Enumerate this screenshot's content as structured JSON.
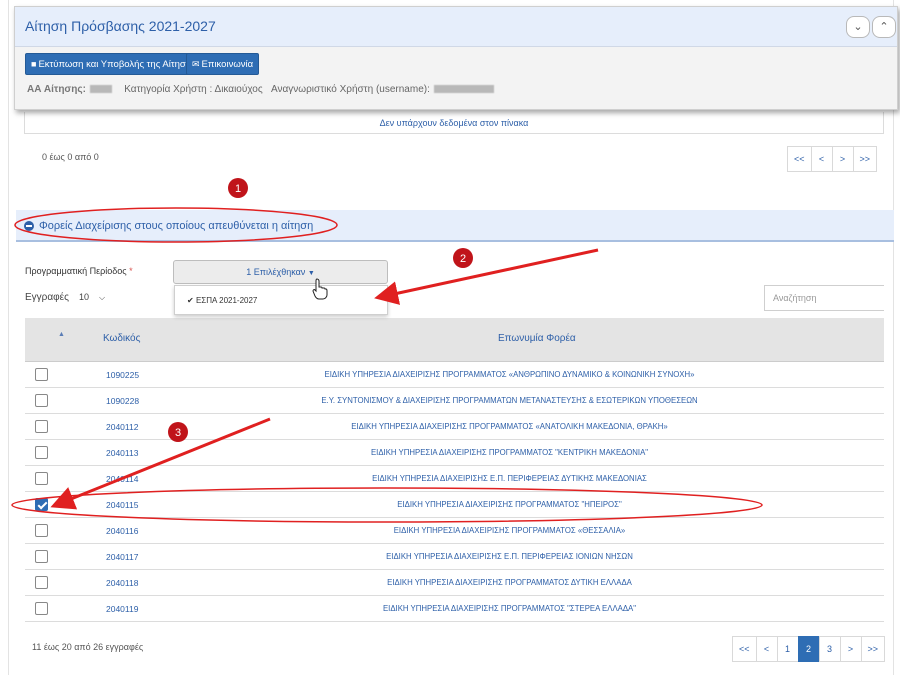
{
  "header": {
    "title": "Αίτηση Πρόσβασης 2021-2027",
    "print_button": "Εκτύπωση και Υποβολής της Αίτησης",
    "contact_button": "Επικοινωνία",
    "application_label": "ΑΑ Αίτησης:",
    "user_category": "Κατηγορία Χρήστη : Δικαιούχος",
    "username_label": "Αναγνωριστικό Χρήστη (username):",
    "collapse_icon": "chevron-down-icon",
    "expand_icon": "chevron-up-icon"
  },
  "top_table": {
    "empty_message": "Δεν υπάρχουν δεδομένα στον πίνακα",
    "summary": "0 έως 0 από 0",
    "pager": [
      "<<",
      "<",
      ">",
      ">>"
    ]
  },
  "section": {
    "title": "Φορείς Διαχείρισης στους οποίους απευθύνεται η αίτηση",
    "period_label": "Προγραμματική Περίοδος",
    "required_mark": "*",
    "period_value": "1 Επιλέχθηκαν",
    "dropdown_option": "ΕΣΠΑ 2021-2027",
    "length_label": "Εγγραφές",
    "length_value": "10",
    "search_placeholder": "Αναζήτηση"
  },
  "table": {
    "columns": [
      "Κωδικός",
      "Επωνυμία Φορέα"
    ],
    "rows": [
      {
        "code": "1090225",
        "name": "ΕΙΔΙΚΗ ΥΠΗΡΕΣΙΑ ΔΙΑΧΕΙΡΙΣΗΣ ΠΡΟΓΡΑΜΜΑΤΟΣ «ΑΝΘΡΩΠΙΝΟ ΔΥΝΑΜΙΚΟ & ΚΟΙΝΩΝΙΚΗ ΣΥΝΟΧΗ»",
        "checked": false
      },
      {
        "code": "1090228",
        "name": "Ε.Υ. ΣΥΝΤΟΝΙΣΜΟΥ & ΔΙΑΧΕΙΡΙΣΗΣ ΠΡΟΓΡΑΜΜΑΤΩΝ ΜΕΤΑΝΑΣΤΕΥΣΗΣ & ΕΣΩΤΕΡΙΚΩΝ ΥΠΟΘΕΣΕΩΝ",
        "checked": false
      },
      {
        "code": "2040112",
        "name": "ΕΙΔΙΚΗ ΥΠΗΡΕΣΙΑ ΔΙΑΧΕΙΡΙΣΗΣ ΠΡΟΓΡΑΜΜΑΤΟΣ «ΑΝΑΤΟΛΙΚΗ ΜΑΚΕΔΟΝΙΑ, ΘΡΑΚΗ»",
        "checked": false
      },
      {
        "code": "2040113",
        "name": "ΕΙΔΙΚΗ ΥΠΗΡΕΣΙΑ ΔΙΑΧΕΙΡΙΣΗΣ ΠΡΟΓΡΑΜΜΑΤΟΣ \"ΚΕΝΤΡΙΚΗ ΜΑΚΕΔΟΝΙΑ\"",
        "checked": false
      },
      {
        "code": "2040114",
        "name": "ΕΙΔΙΚΗ ΥΠΗΡΕΣΙΑ ΔΙΑΧΕΙΡΙΣΗΣ Ε.Π. ΠΕΡΙΦΕΡΕΙΑΣ ΔΥΤΙΚΗΣ ΜΑΚΕΔΟΝΙΑΣ",
        "checked": false
      },
      {
        "code": "2040115",
        "name": "ΕΙΔΙΚΗ ΥΠΗΡΕΣΙΑ ΔΙΑΧΕΙΡΙΣΗΣ ΠΡΟΓΡΑΜΜΑΤΟΣ \"ΗΠΕΙΡΟΣ\"",
        "checked": true
      },
      {
        "code": "2040116",
        "name": "ΕΙΔΙΚΗ ΥΠΗΡΕΣΙΑ ΔΙΑΧΕΙΡΙΣΗΣ ΠΡΟΓΡΑΜΜΑΤΟΣ «ΘΕΣΣΑΛΙΑ»",
        "checked": false
      },
      {
        "code": "2040117",
        "name": "ΕΙΔΙΚΗ ΥΠΗΡΕΣΙΑ ΔΙΑΧΕΙΡΙΣΗΣ Ε.Π. ΠΕΡΙΦΕΡΕΙΑΣ ΙΟΝΙΩΝ ΝΗΣΩΝ",
        "checked": false
      },
      {
        "code": "2040118",
        "name": "ΕΙΔΙΚΗ ΥΠΗΡΕΣΙΑ ΔΙΑΧΕΙΡΙΣΗΣ ΠΡΟΓΡΑΜΜΑΤΟΣ ΔΥΤΙΚΗ ΕΛΛΑΔΑ",
        "checked": false
      },
      {
        "code": "2040119",
        "name": "ΕΙΔΙΚΗ ΥΠΗΡΕΣΙΑ ΔΙΑΧΕΙΡΙΣΗΣ ΠΡΟΓΡΑΜΜΑΤΟΣ \"ΣΤΕΡΕΑ ΕΛΛΑΔΑ\"",
        "checked": false
      }
    ],
    "summary": "11 έως 20 από 26 εγγραφές",
    "pager": [
      "<<",
      "<",
      "1",
      "2",
      "3",
      ">",
      ">>"
    ],
    "active_page": "2"
  },
  "annotations": {
    "markers": [
      "1",
      "2",
      "3"
    ],
    "color": "#e02020"
  },
  "colors": {
    "accent": "#2e6db4",
    "link": "#2d5fa8",
    "header_bg": "#e6eefb"
  }
}
